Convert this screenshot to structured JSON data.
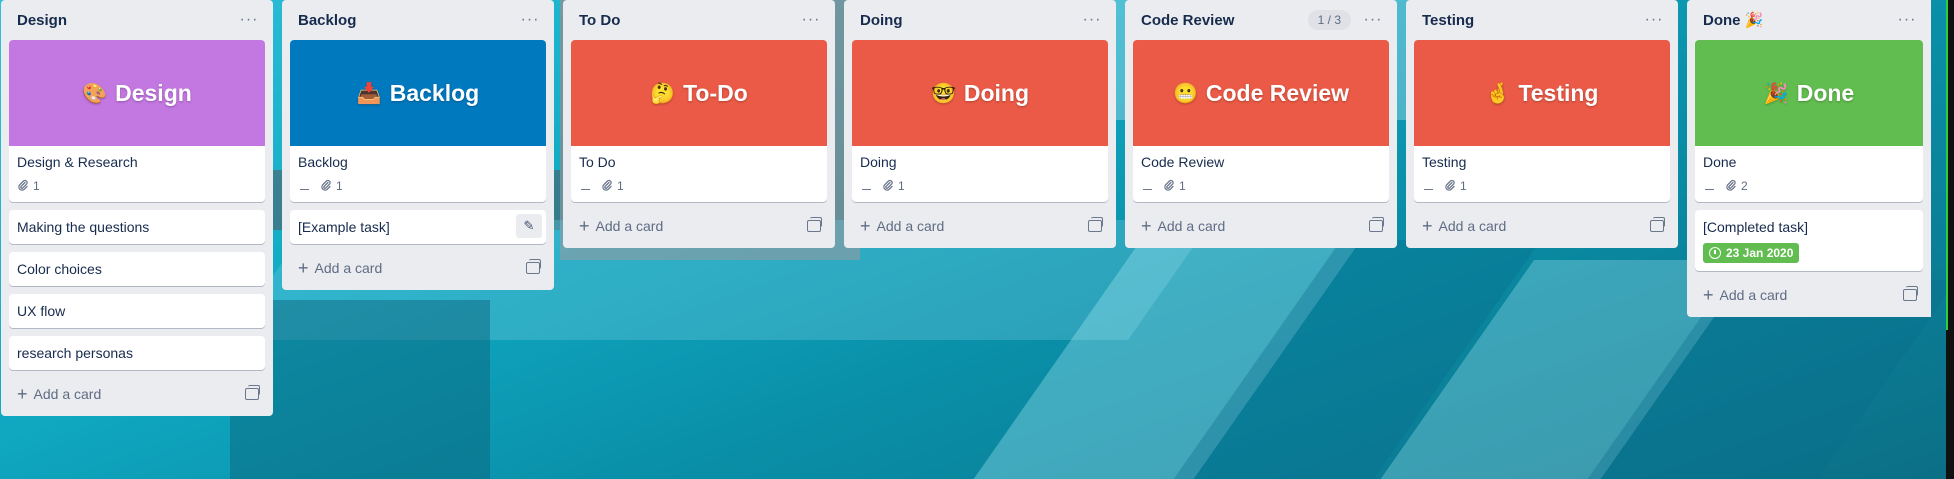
{
  "board": {
    "add_card_label": "Add a card",
    "lists": [
      {
        "title": "Design",
        "cover_card": {
          "cover_color": "#c377e0",
          "cover_emoji": "🎨",
          "cover_text": "Design",
          "title": "Design & Research",
          "has_description": false,
          "attachments": "1"
        },
        "cards": [
          "Making the questions",
          "Color choices",
          "UX flow",
          "research personas"
        ]
      },
      {
        "title": "Backlog",
        "cover_card": {
          "cover_color": "#0079bf",
          "cover_emoji": "📥",
          "cover_text": "Backlog",
          "title": "Backlog",
          "has_description": true,
          "attachments": "1"
        },
        "cards": [
          "[Example task]"
        ]
      },
      {
        "title": "To Do",
        "cover_card": {
          "cover_color": "#eb5a46",
          "cover_emoji": "🤔",
          "cover_text": "To-Do",
          "title": "To Do",
          "has_description": true,
          "attachments": "1"
        },
        "cards": []
      },
      {
        "title": "Doing",
        "cover_card": {
          "cover_color": "#eb5a46",
          "cover_emoji": "🤓",
          "cover_text": "Doing",
          "title": "Doing",
          "has_description": true,
          "attachments": "1"
        },
        "cards": []
      },
      {
        "title": "Code Review",
        "wip": "1 / 3",
        "cover_card": {
          "cover_color": "#eb5a46",
          "cover_emoji": "😬",
          "cover_text": "Code Review",
          "title": "Code Review",
          "has_description": true,
          "attachments": "1"
        },
        "cards": []
      },
      {
        "title": "Testing",
        "cover_card": {
          "cover_color": "#eb5a46",
          "cover_emoji": "🤞",
          "cover_text": "Testing",
          "title": "Testing",
          "has_description": true,
          "attachments": "1"
        },
        "cards": []
      },
      {
        "title": "Done 🎉",
        "cover_card": {
          "cover_color": "#61bd4f",
          "cover_emoji": "🎉",
          "cover_text": "Done",
          "title": "Done",
          "has_description": true,
          "attachments": "2"
        },
        "cards": [],
        "completed_card": {
          "title": "[Completed task]",
          "due": "23 Jan 2020",
          "due_color": "#61bd4f"
        }
      }
    ]
  }
}
